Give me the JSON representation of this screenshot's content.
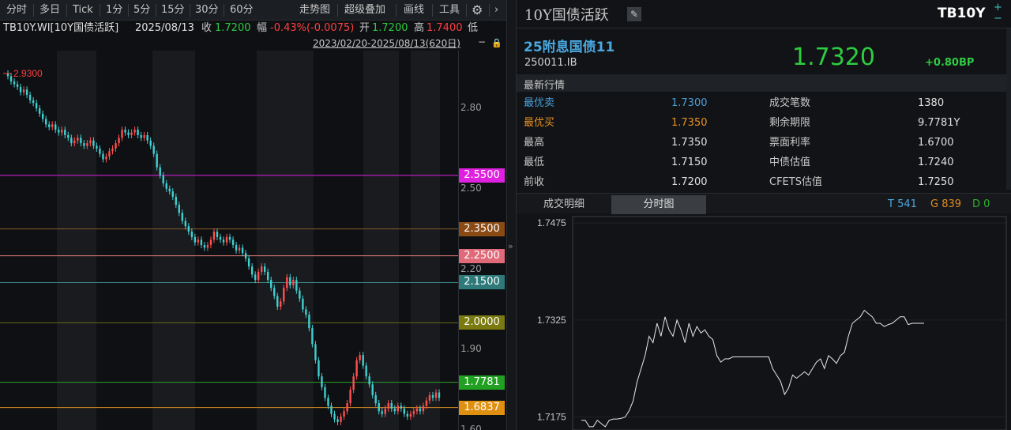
{
  "toolbar": {
    "items": [
      "分时",
      "多日",
      "Tick",
      "1分",
      "5分",
      "15分",
      "30分",
      "60分"
    ],
    "right_items": [
      "走势图",
      "超级叠加",
      "画线",
      "工具"
    ],
    "gear_icon": "gear-icon",
    "more_icon": "chevron-right-icon"
  },
  "info": {
    "symbol": "TB10Y.WI[10Y国债活跃]",
    "date": "2025/08/13",
    "close_label": "收",
    "close_value": "1.7200",
    "change_label": "幅",
    "change_value": "-0.43%(-0.0075)",
    "open_label": "开",
    "open_value": "1.7200",
    "high_label": "高",
    "high_value": "1.7400",
    "low_label": "低"
  },
  "range": {
    "text": "2023/02/20-2025/08/13(620日)",
    "minus_icon": "minus-icon",
    "lock_icon": "lock-icon"
  },
  "kline": {
    "max_label": "2.9300",
    "y_ticks": [
      "2.80",
      "2.50",
      "2.20",
      "1.90",
      "1.60"
    ],
    "y_tick_values": [
      2.8,
      2.5,
      2.2,
      1.9,
      1.6
    ],
    "ymin": 1.6,
    "ymax": 2.98,
    "close_series": [
      2.93,
      2.92,
      2.9,
      2.89,
      2.88,
      2.86,
      2.87,
      2.85,
      2.83,
      2.82,
      2.8,
      2.78,
      2.76,
      2.74,
      2.73,
      2.74,
      2.72,
      2.71,
      2.72,
      2.7,
      2.69,
      2.67,
      2.68,
      2.69,
      2.67,
      2.66,
      2.67,
      2.68,
      2.66,
      2.65,
      2.63,
      2.61,
      2.62,
      2.64,
      2.65,
      2.67,
      2.69,
      2.72,
      2.71,
      2.7,
      2.71,
      2.72,
      2.7,
      2.69,
      2.7,
      2.68,
      2.66,
      2.63,
      2.58,
      2.55,
      2.52,
      2.5,
      2.49,
      2.47,
      2.44,
      2.41,
      2.38,
      2.36,
      2.34,
      2.32,
      2.3,
      2.31,
      2.29,
      2.28,
      2.29,
      2.31,
      2.34,
      2.32,
      2.31,
      2.3,
      2.32,
      2.31,
      2.29,
      2.27,
      2.28,
      2.26,
      2.24,
      2.21,
      2.18,
      2.16,
      2.19,
      2.21,
      2.19,
      2.16,
      2.13,
      2.1,
      2.06,
      2.08,
      2.13,
      2.17,
      2.14,
      2.16,
      2.12,
      2.09,
      2.05,
      2.03,
      1.98,
      1.92,
      1.86,
      1.8,
      1.76,
      1.72,
      1.69,
      1.66,
      1.64,
      1.63,
      1.65,
      1.67,
      1.7,
      1.75,
      1.8,
      1.86,
      1.88,
      1.84,
      1.8,
      1.77,
      1.73,
      1.7,
      1.67,
      1.66,
      1.68,
      1.7,
      1.68,
      1.67,
      1.69,
      1.68,
      1.66,
      1.65,
      1.66,
      1.67,
      1.68,
      1.67,
      1.69,
      1.71,
      1.73,
      1.72,
      1.74,
      1.72
    ],
    "hlines": [
      {
        "value": 2.55,
        "label": "2.5500",
        "color": "#e020e0",
        "bg": "#e020e0"
      },
      {
        "value": 2.35,
        "label": "2.3500",
        "color": "#8a5a2a",
        "bg": "#8a4a14"
      },
      {
        "value": 2.25,
        "label": "2.2500",
        "color": "#f08080",
        "bg": "#e06a7a"
      },
      {
        "value": 2.15,
        "label": "2.1500",
        "color": "#3a8a8a",
        "bg": "#2e7a7a"
      },
      {
        "value": 2.0,
        "label": "2.0000",
        "color": "#6a6a14",
        "bg": "#7a7a10"
      },
      {
        "value": 1.7781,
        "label": "1.7781",
        "color": "#30a030",
        "bg": "#22a022"
      },
      {
        "value": 1.6837,
        "label": "1.6837",
        "color": "#d08a20",
        "bg": "#e09010"
      }
    ]
  },
  "right": {
    "title": "10Y国债活跃",
    "edit_icon": "pencil-icon",
    "code": "TB10Y",
    "plus_icon": "plus-icon",
    "bond_name": "25附息国债11",
    "bond_code": "250011.IB",
    "price": "1.7320",
    "change_bp": "+0.80BP",
    "section_label": "最新行情",
    "quotes": [
      {
        "l1": "最优卖",
        "v1": "1.7300",
        "l2": "成交笔数",
        "v2": "1380",
        "c1": "#4a9fd8",
        "cv1": "#4a9fd8"
      },
      {
        "l1": "最优买",
        "v1": "1.7350",
        "l2": "剩余期限",
        "v2": "9.7781Y",
        "c1": "#e89020",
        "cv1": "#e89020"
      },
      {
        "l1": "最高",
        "v1": "1.7350",
        "l2": "票面利率",
        "v2": "1.6700",
        "c1": "#c8c8c8",
        "cv1": "#e0e0e0"
      },
      {
        "l1": "最低",
        "v1": "1.7150",
        "l2": "中债估值",
        "v2": "1.7240",
        "c1": "#c8c8c8",
        "cv1": "#e0e0e0"
      },
      {
        "l1": "前收",
        "v1": "1.7200",
        "l2": "CFETS估值",
        "v2": "1.7250",
        "c1": "#c8c8c8",
        "cv1": "#e0e0e0"
      }
    ],
    "tabs": [
      "成交明细",
      "分时图"
    ],
    "counts": [
      {
        "text": "T 541",
        "color": "#4aa8e0"
      },
      {
        "text": "G 839",
        "color": "#e08a20"
      },
      {
        "text": "D 0",
        "color": "#30b030"
      }
    ]
  },
  "intraday": {
    "y_ticks": [
      "1.7475",
      "1.7325",
      "1.7175"
    ],
    "y_tick_values": [
      1.7475,
      1.7325,
      1.7175
    ],
    "ymin": 1.7155,
    "ymax": 1.7485,
    "series": [
      1.717,
      1.717,
      1.716,
      1.716,
      1.717,
      1.7165,
      1.716,
      1.717,
      1.7172,
      1.7172,
      1.7173,
      1.7175,
      1.7185,
      1.72,
      1.723,
      1.725,
      1.727,
      1.73,
      1.729,
      1.732,
      1.73,
      1.733,
      1.731,
      1.73,
      1.7325,
      1.731,
      1.729,
      1.732,
      1.73,
      1.7315,
      1.7305,
      1.731,
      1.73,
      1.7295,
      1.727,
      1.726,
      1.7265,
      1.7265,
      1.7268,
      1.7268,
      1.7268,
      1.7268,
      1.7268,
      1.7268,
      1.7268,
      1.7268,
      1.7268,
      1.7268,
      1.725,
      1.724,
      1.723,
      1.721,
      1.722,
      1.724,
      1.7235,
      1.724,
      1.7245,
      1.724,
      1.725,
      1.726,
      1.7265,
      1.725,
      1.727,
      1.7265,
      1.7258,
      1.727,
      1.7275,
      1.73,
      1.732,
      1.7325,
      1.733,
      1.734,
      1.7335,
      1.733,
      1.732,
      1.732,
      1.7315,
      1.7318,
      1.732,
      1.7325,
      1.733,
      1.733,
      1.7318,
      1.732,
      1.732,
      1.732,
      1.732
    ]
  }
}
